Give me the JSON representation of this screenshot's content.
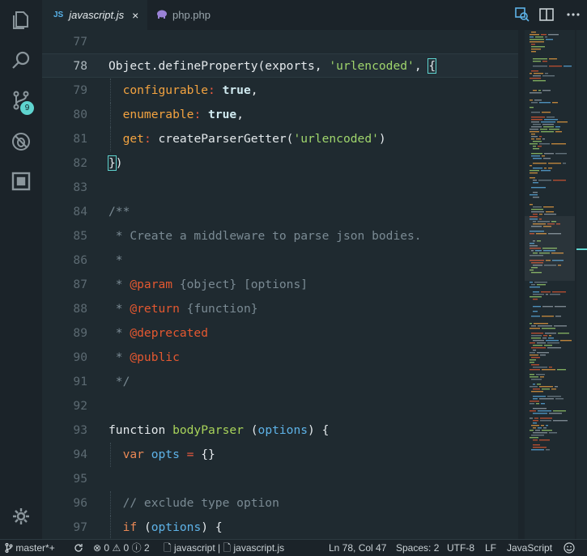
{
  "activity_bar": {
    "scm_badge": "9"
  },
  "tabs": [
    {
      "icon_label": "JS",
      "label": "javascript.js",
      "close": "×"
    },
    {
      "label": "php.php"
    }
  ],
  "editor": {
    "lines": [
      {
        "n": "77",
        "tokens": []
      },
      {
        "n": "78",
        "current": true,
        "tokens": [
          {
            "t": "Object.defineProperty(exports, ",
            "c": "t-p"
          },
          {
            "t": "'urlencoded'",
            "c": "t-str"
          },
          {
            "t": ", ",
            "c": "t-p"
          },
          {
            "t": "{",
            "c": "t-p bracket-hl"
          }
        ]
      },
      {
        "n": "79",
        "tokens": [
          {
            "t": "  ",
            "c": "t-p"
          },
          {
            "t": "configurable",
            "c": "t-prop"
          },
          {
            "t": ": ",
            "c": "t-op"
          },
          {
            "t": "true",
            "c": "t-bool"
          },
          {
            "t": ",",
            "c": "t-p"
          }
        ]
      },
      {
        "n": "80",
        "tokens": [
          {
            "t": "  ",
            "c": "t-p"
          },
          {
            "t": "enumerable",
            "c": "t-prop"
          },
          {
            "t": ": ",
            "c": "t-op"
          },
          {
            "t": "true",
            "c": "t-bool"
          },
          {
            "t": ",",
            "c": "t-p"
          }
        ]
      },
      {
        "n": "81",
        "tokens": [
          {
            "t": "  ",
            "c": "t-p"
          },
          {
            "t": "get",
            "c": "t-prop"
          },
          {
            "t": ": ",
            "c": "t-op"
          },
          {
            "t": "createParserGetter(",
            "c": "t-p"
          },
          {
            "t": "'urlencoded'",
            "c": "t-str"
          },
          {
            "t": ")",
            "c": "t-p"
          }
        ]
      },
      {
        "n": "82",
        "tokens": [
          {
            "t": "}",
            "c": "t-p bracket-hl"
          },
          {
            "t": ")",
            "c": "t-p"
          }
        ]
      },
      {
        "n": "83",
        "tokens": []
      },
      {
        "n": "84",
        "tokens": [
          {
            "t": "/**",
            "c": "t-com"
          }
        ]
      },
      {
        "n": "85",
        "tokens": [
          {
            "t": " * Create a middleware to parse json bodies.",
            "c": "t-com"
          }
        ]
      },
      {
        "n": "86",
        "tokens": [
          {
            "t": " *",
            "c": "t-com"
          }
        ]
      },
      {
        "n": "87",
        "tokens": [
          {
            "t": " * ",
            "c": "t-com"
          },
          {
            "t": "@param",
            "c": "t-doc"
          },
          {
            "t": " {object} [options]",
            "c": "t-com"
          }
        ]
      },
      {
        "n": "88",
        "tokens": [
          {
            "t": " * ",
            "c": "t-com"
          },
          {
            "t": "@return",
            "c": "t-doc"
          },
          {
            "t": " {function}",
            "c": "t-com"
          }
        ]
      },
      {
        "n": "89",
        "tokens": [
          {
            "t": " * ",
            "c": "t-com"
          },
          {
            "t": "@deprecated",
            "c": "t-doc"
          }
        ]
      },
      {
        "n": "90",
        "tokens": [
          {
            "t": " * ",
            "c": "t-com"
          },
          {
            "t": "@public",
            "c": "t-doc"
          }
        ]
      },
      {
        "n": "91",
        "tokens": [
          {
            "t": " */",
            "c": "t-com"
          }
        ]
      },
      {
        "n": "92",
        "tokens": []
      },
      {
        "n": "93",
        "tokens": [
          {
            "t": "function ",
            "c": "t-p"
          },
          {
            "t": "bodyParser",
            "c": "t-fn"
          },
          {
            "t": " (",
            "c": "t-p"
          },
          {
            "t": "options",
            "c": "t-param"
          },
          {
            "t": ") {",
            "c": "t-p"
          }
        ]
      },
      {
        "n": "94",
        "tokens": [
          {
            "t": "  ",
            "c": "t-p"
          },
          {
            "t": "var ",
            "c": "t-kw"
          },
          {
            "t": "opts",
            "c": "t-param"
          },
          {
            "t": " = ",
            "c": "t-op"
          },
          {
            "t": "{}",
            "c": "t-p"
          }
        ]
      },
      {
        "n": "95",
        "tokens": []
      },
      {
        "n": "96",
        "tokens": [
          {
            "t": "  ",
            "c": "t-p"
          },
          {
            "t": "// exclude type option",
            "c": "t-com"
          }
        ]
      },
      {
        "n": "97",
        "tokens": [
          {
            "t": "  ",
            "c": "t-p"
          },
          {
            "t": "if",
            "c": "t-kw"
          },
          {
            "t": " (",
            "c": "t-p"
          },
          {
            "t": "options",
            "c": "t-param"
          },
          {
            "t": ") {",
            "c": "t-p"
          }
        ]
      }
    ]
  },
  "status_bar": {
    "branch": "master*+",
    "errors": "0",
    "warnings": "0",
    "infos": "2",
    "language_mode": "javascript",
    "file": "javascript.js",
    "position": "Ln 78, Col 47",
    "spaces": "Spaces: 2",
    "encoding": "UTF-8",
    "eol": "LF",
    "language": "JavaScript"
  },
  "colors": {
    "accent": "#5fd4cf",
    "string": "#9fd56c",
    "property": "#f3a340",
    "doc_tag": "#e45830",
    "parameter": "#5eb3e8"
  }
}
